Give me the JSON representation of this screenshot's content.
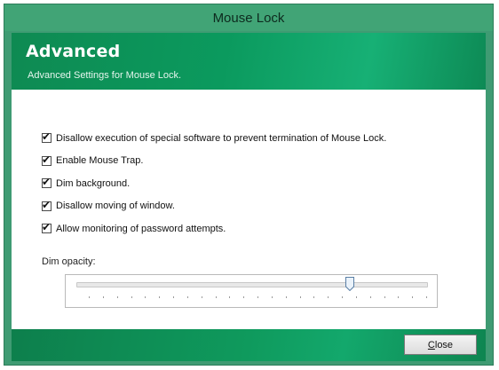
{
  "window": {
    "title": "Mouse Lock"
  },
  "header": {
    "title": "Advanced",
    "subtitle": "Advanced Settings for Mouse Lock."
  },
  "options": [
    {
      "label": "Disallow execution of special software to prevent termination of Mouse Lock.",
      "checked": true
    },
    {
      "label": "Enable Mouse Trap.",
      "checked": true
    },
    {
      "label": "Dim background.",
      "checked": true
    },
    {
      "label": "Disallow moving of window.",
      "checked": true
    },
    {
      "label": "Allow monitoring of password attempts.",
      "checked": true
    }
  ],
  "dim_opacity": {
    "label": "Dim opacity:",
    "value_fraction": 0.78,
    "tick_count": 25
  },
  "footer": {
    "close_label_mnemonic": "C",
    "close_label_rest": "lose"
  },
  "icons": {
    "checkbox_checked": "check-mark-icon",
    "slider_thumb": "slider-thumb-icon"
  },
  "colors": {
    "titlebar": "#41a476",
    "header_green": "#0b9a5e",
    "footer_green": "#0f9a5d"
  }
}
